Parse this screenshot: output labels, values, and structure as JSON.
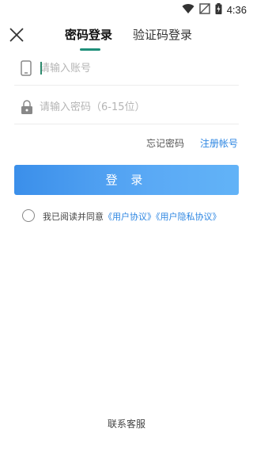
{
  "status_bar": {
    "time": "4:36",
    "icons": [
      "wifi-icon",
      "no-signal-icon",
      "battery-charging-icon"
    ]
  },
  "header": {
    "close_icon": "close-icon",
    "tabs": [
      {
        "label": "密码登录",
        "active": true
      },
      {
        "label": "验证码登录",
        "active": false
      }
    ],
    "accent_color": "#1f8f7a"
  },
  "form": {
    "account": {
      "icon": "phone-icon",
      "placeholder": "请输入账号",
      "value": ""
    },
    "password": {
      "icon": "lock-icon",
      "placeholder": "请输入密码（6-15位）",
      "value": ""
    },
    "forgot_label": "忘记密码",
    "register_label": "注册帐号",
    "login_label": "登 录",
    "button_color": "#4a9cf0",
    "link_color": "#2d86e2"
  },
  "agreement": {
    "checked": false,
    "prefix": "我已阅读并同意",
    "user_agreement": "《用户协议》",
    "privacy_agreement": "《用户隐私协议》"
  },
  "footer": {
    "contact_label": "联系客服"
  }
}
